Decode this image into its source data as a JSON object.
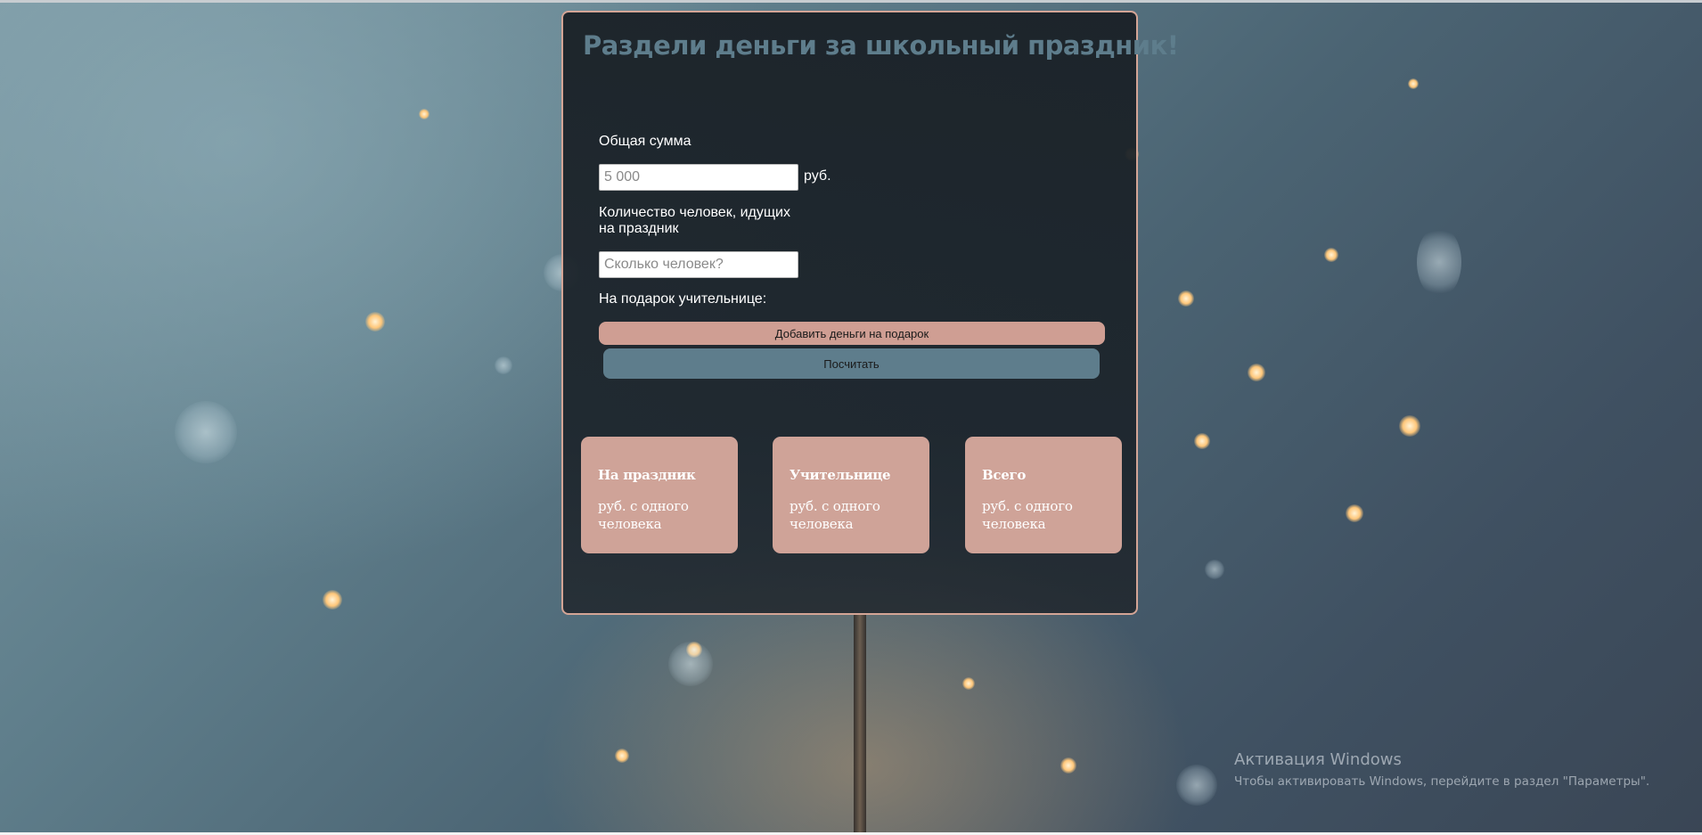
{
  "page": {
    "title": "Раздели деньги за школьный праздник!"
  },
  "form": {
    "total_label": "Общая сумма",
    "total_placeholder": "5 000",
    "total_unit": "руб.",
    "people_label_line1": "Количество человек, идущих",
    "people_label_line2": "на праздник",
    "people_placeholder": "Сколько человек?",
    "gift_label": "На подарок учительнице:",
    "add_gift_button": "Добавить деньги на подарок",
    "calculate_button": "Посчитать"
  },
  "results": [
    {
      "title": "На праздник",
      "text_line1": "руб. с одного",
      "text_line2": "человека"
    },
    {
      "title": "Учительнице",
      "text_line1": "руб. с одного",
      "text_line2": "человека"
    },
    {
      "title": "Всего",
      "text_line1": "руб. с одного",
      "text_line2": "человека"
    }
  ],
  "os_watermark": {
    "title": "Активация Windows",
    "subtitle": "Чтобы активировать Windows, перейдите в раздел \"Параметры\"."
  },
  "colors": {
    "accent_rose": "#cfa398",
    "accent_slate": "#5e7d8c",
    "panel_bg": "#1c242b"
  }
}
